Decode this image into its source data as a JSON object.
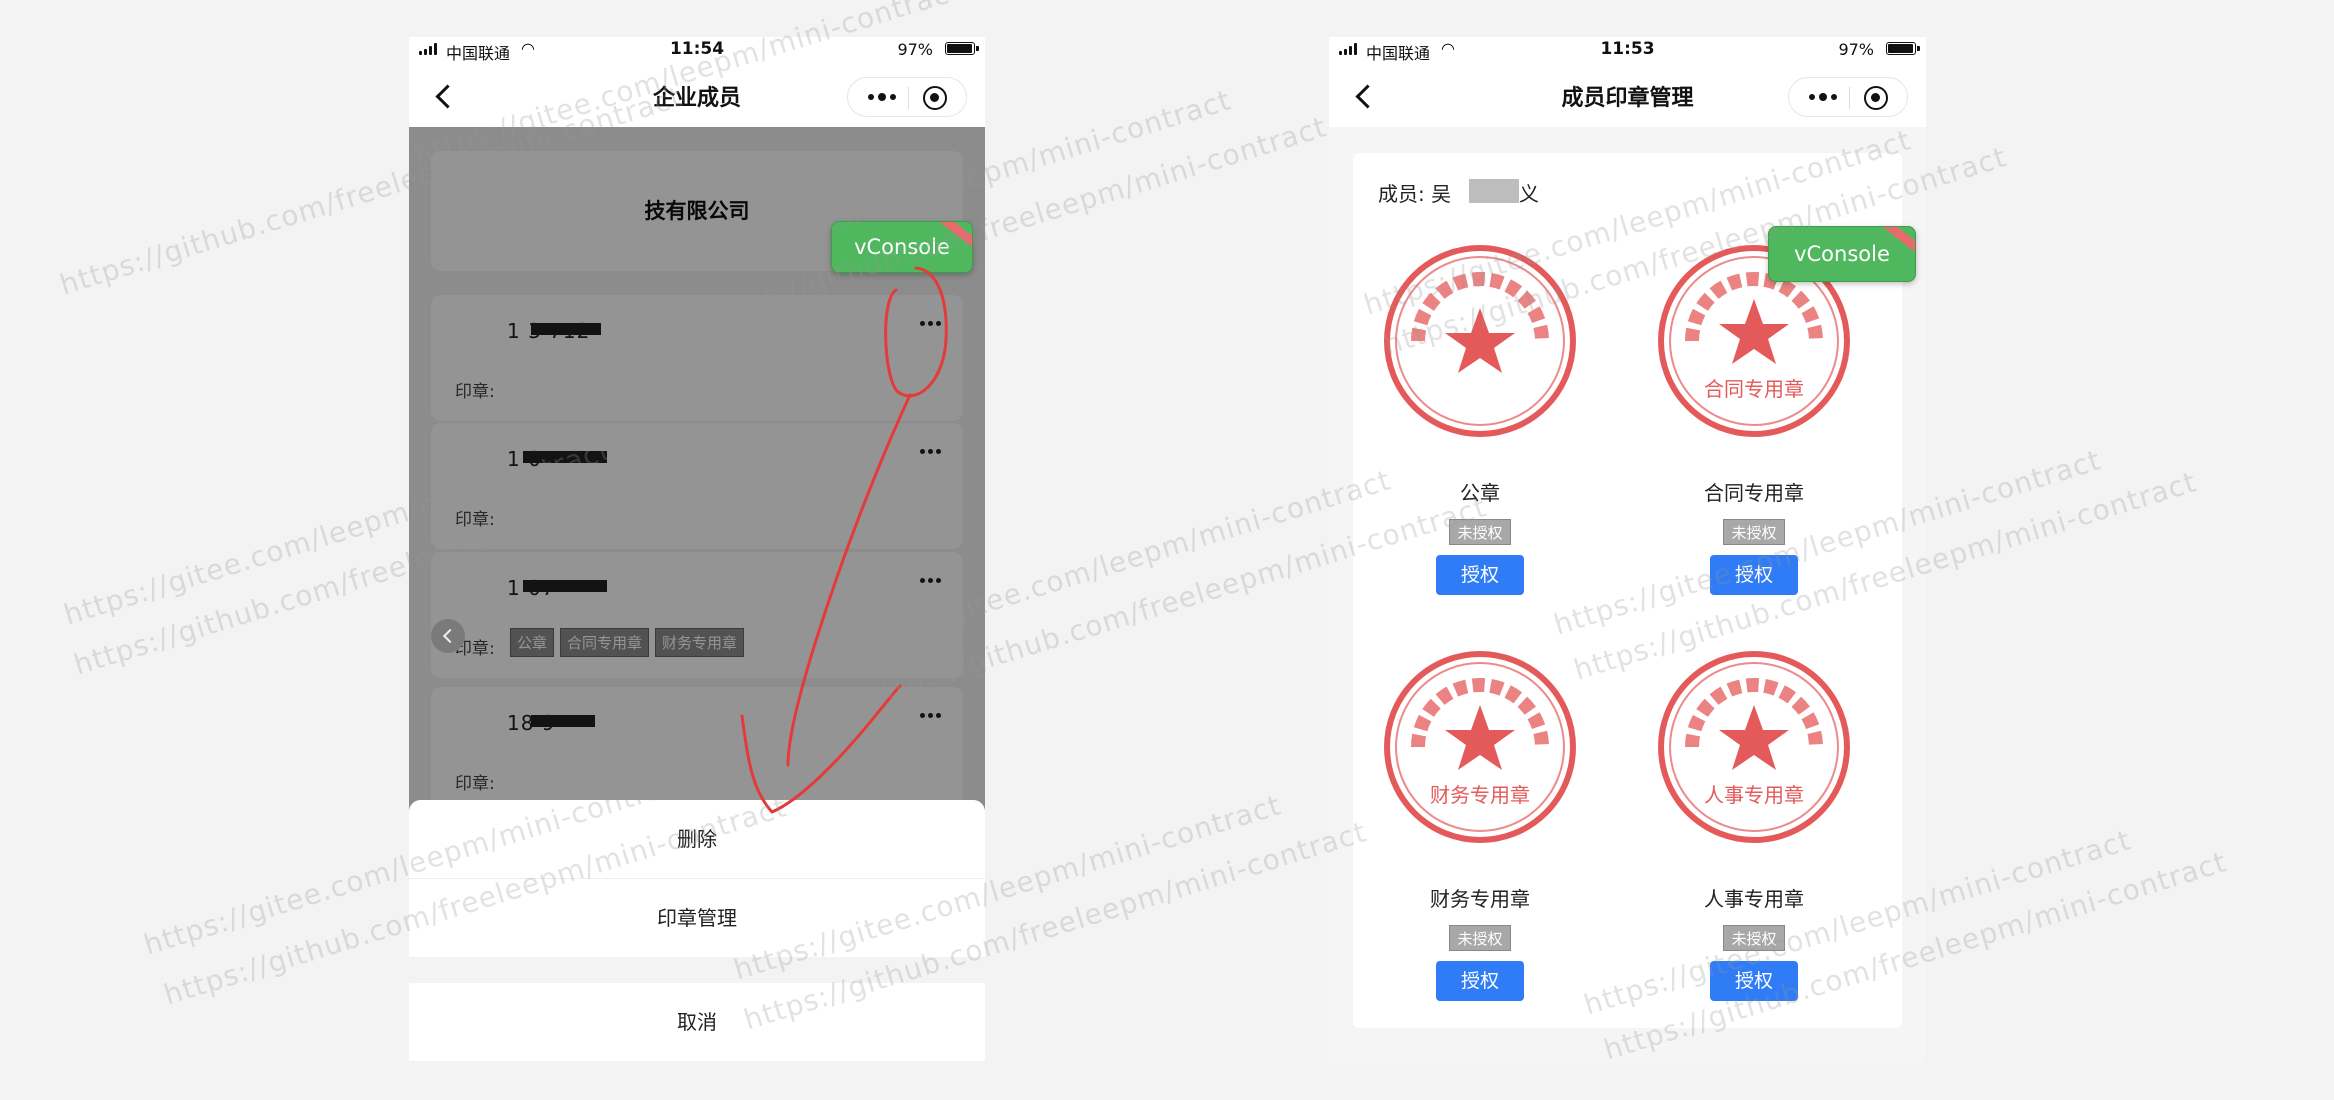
{
  "left_phone": {
    "status": {
      "carrier": "中国联通",
      "time": "11:54",
      "battery": "97%",
      "battery_level": 0.97
    },
    "nav": {
      "title": "企业成员"
    },
    "company": {
      "name": "技有限公司"
    },
    "members": [
      {
        "phone": "1  3  712",
        "seal_label": "印章:",
        "tags": []
      },
      {
        "phone": "1  0",
        "seal_label": "印章:",
        "tags": []
      },
      {
        "phone": "1  07",
        "seal_label": "印章:",
        "tags": [
          "公章",
          "合同专用章",
          "财务专用章"
        ]
      },
      {
        "phone": "18  9",
        "seal_label": "印章:",
        "tags": []
      }
    ],
    "action_sheet": {
      "delete": "删除",
      "seal_manage": "印章管理",
      "cancel": "取消"
    }
  },
  "right_phone": {
    "status": {
      "carrier": "中国联通",
      "time": "11:53",
      "battery": "97%",
      "battery_level": 0.97
    },
    "nav": {
      "title": "成员印章管理"
    },
    "member": {
      "label": "成员:",
      "name_start": "吴",
      "name_end": "义"
    },
    "seals": [
      {
        "name": "公章",
        "stamp_text": "",
        "status": "未授权",
        "action": "授权"
      },
      {
        "name": "合同专用章",
        "stamp_text": "合同专用章",
        "status": "未授权",
        "action": "授权"
      },
      {
        "name": "财务专用章",
        "stamp_text": "财务专用章",
        "status": "未授权",
        "action": "授权"
      },
      {
        "name": "人事专用章",
        "stamp_text": "人事专用章",
        "status": "未授权",
        "action": "授权"
      }
    ]
  },
  "vconsole": {
    "label": "vConsole"
  },
  "seal_color": "#e45a5a",
  "accent_blue": "#2f7cf6",
  "vconsole_green": "#4fb85e",
  "watermark": [
    "https://gitee.com/leepm/mini-contract",
    "https://github.com/freeleepm/mini-contract"
  ]
}
